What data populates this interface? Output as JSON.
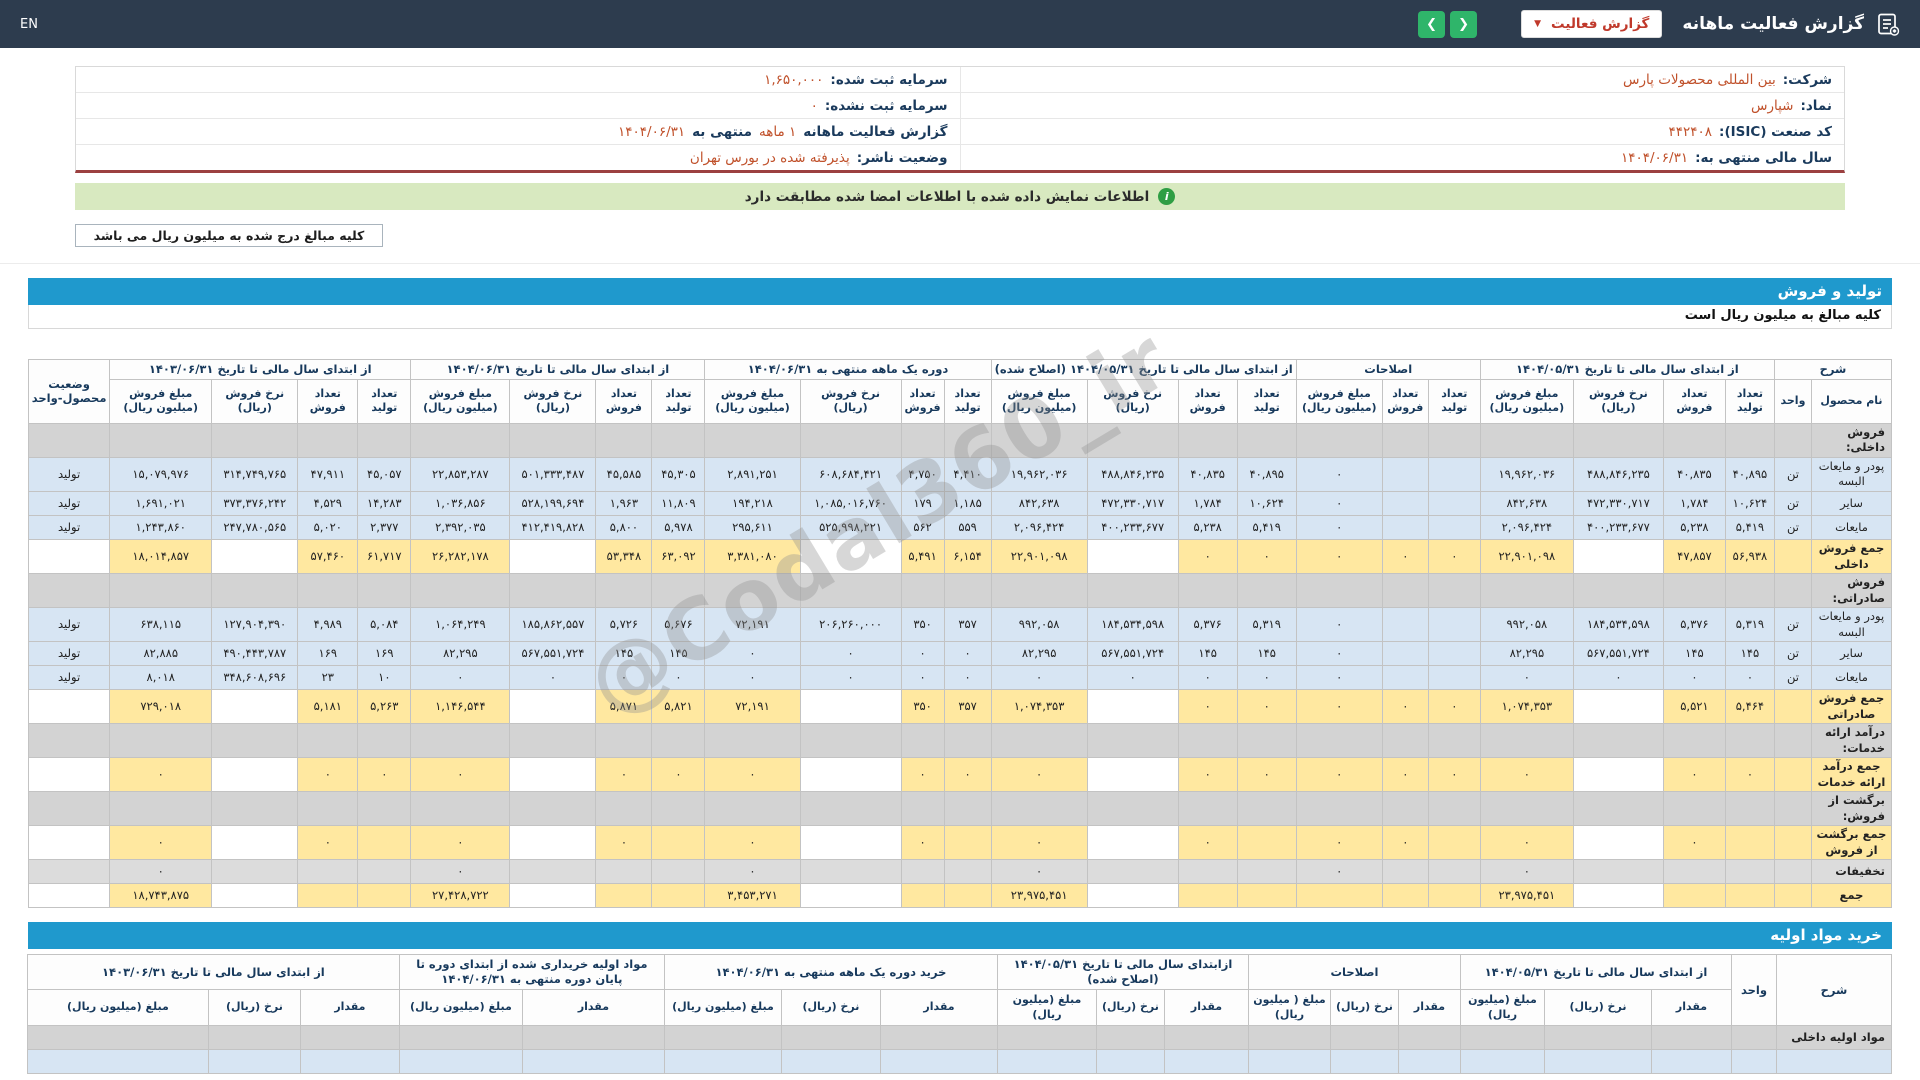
{
  "topbar": {
    "title": "گزارش فعالیت ماهانه",
    "dropdown_label": "گزارش فعالیت",
    "dropdown_caret": "▼",
    "prev_label": "❮",
    "next_label": "❯",
    "en_label": "EN"
  },
  "colors": {
    "topbar_bg": "#2d3c4e",
    "section_bar_bg": "#1f99cd",
    "nav_button_green": "#2fb56a",
    "dropdown_red": "#c0392b",
    "value_orange": "#c0512b",
    "banner_green_bg": "#d8e9c0",
    "banner_icon_green": "#2f9e44",
    "row_blue": "#d7e5f3",
    "row_yellow": "#ffe8a0",
    "row_gray": "#d3d3d3",
    "info_bottom_border_red": "#9c4040"
  },
  "company": {
    "rows": [
      {
        "right": [
          {
            "label": "شرکت:"
          },
          {
            "value": "بین المللی محصولات پارس"
          }
        ],
        "left": [
          {
            "label": "سرمایه ثبت شده:"
          },
          {
            "value": "۱,۶۵۰,۰۰۰"
          }
        ]
      },
      {
        "right": [
          {
            "label": "نماد:"
          },
          {
            "value": "شپارس"
          }
        ],
        "left": [
          {
            "label": "سرمایه ثبت نشده:"
          },
          {
            "value": "۰"
          }
        ]
      },
      {
        "right": [
          {
            "label": "کد صنعت (ISIC):"
          },
          {
            "value": "۴۴۲۴۰۸"
          }
        ],
        "left": [
          {
            "label": "گزارش فعالیت ماهانه"
          },
          {
            "value": "۱ ماهه"
          },
          {
            "label": "منتهی به"
          },
          {
            "value": "۱۴۰۴/۰۶/۳۱"
          }
        ]
      },
      {
        "right": [
          {
            "label": "سال مالی منتهی به:"
          },
          {
            "value": "۱۴۰۴/۰۶/۳۱"
          }
        ],
        "left": [
          {
            "label": "وضعیت ناشر:"
          },
          {
            "value": "پذیرفته شده در بورس تهران"
          }
        ]
      }
    ]
  },
  "banner": {
    "icon_glyph": "i",
    "text": "اطلاعات نمایش داده شده با اطلاعات امضا شده مطابقت دارد"
  },
  "amounts_note": "کلیه مبالغ درج شده به میلیون ریال می باشد",
  "watermark": "@Codal360_ir",
  "production_section": {
    "title": "تولید و فروش",
    "subtitle": "کلیه مبالغ به میلیون ریال است",
    "table": {
      "sharh_label": "شرح",
      "name_label": "نام محصول",
      "unit_label": "واحد",
      "status_label_line1": "وضعیت",
      "status_label_line2": "محصول-واحد",
      "groups": [
        {
          "label": "از ابتدای سال مالی تا تاریخ ۱۴۰۴/۰۵/۳۱",
          "cols": [
            "تعداد تولید",
            "تعداد فروش",
            "نرخ فروش (ریال)",
            "مبلغ فروش (میلیون ریال)"
          ]
        },
        {
          "label": "اصلاحات",
          "cols": [
            "تعداد تولید",
            "تعداد فروش",
            "مبلغ فروش (میلیون ریال)"
          ]
        },
        {
          "label": "از ابتدای سال مالی تا تاریخ ۱۴۰۴/۰۵/۳۱ (اصلاح شده)",
          "cols": [
            "تعداد تولید",
            "تعداد فروش",
            "نرخ فروش (ریال)",
            "مبلغ فروش (میلیون ریال)"
          ]
        },
        {
          "label": "دوره یک ماهه منتهی به ۱۴۰۴/۰۶/۳۱",
          "cols": [
            "تعداد تولید",
            "تعداد فروش",
            "نرخ فروش (ریال)",
            "مبلغ فروش (میلیون ریال)"
          ]
        },
        {
          "label": "از ابتدای سال مالی تا تاریخ ۱۴۰۴/۰۶/۳۱",
          "cols": [
            "تعداد تولید",
            "تعداد فروش",
            "نرخ فروش (ریال)",
            "مبلغ فروش (میلیون ریال)"
          ]
        },
        {
          "label": "از ابتدای سال مالی تا تاریخ ۱۴۰۳/۰۶/۳۱",
          "cols": [
            "تعداد تولید",
            "تعداد فروش",
            "نرخ فروش (ریال)",
            "مبلغ فروش (میلیون ریال)"
          ]
        }
      ],
      "rows": [
        {
          "type": "section",
          "name": "فروش داخلی:",
          "unit": "",
          "status": "",
          "cells": []
        },
        {
          "type": "product",
          "name": "پودر و مایعات البسه",
          "unit": "تن",
          "status": "تولید",
          "cells": [
            "۴۰,۸۹۵",
            "۴۰,۸۳۵",
            "۴۸۸,۸۴۶,۲۳۵",
            "۱۹,۹۶۲,۰۳۶",
            "",
            "",
            "۰",
            "۴۰,۸۹۵",
            "۴۰,۸۳۵",
            "۴۸۸,۸۴۶,۲۳۵",
            "۱۹,۹۶۲,۰۳۶",
            "۴,۴۱۰",
            "۴,۷۵۰",
            "۶۰۸,۶۸۴,۴۲۱",
            "۲,۸۹۱,۲۵۱",
            "۴۵,۳۰۵",
            "۴۵,۵۸۵",
            "۵۰۱,۳۳۳,۴۸۷",
            "۲۲,۸۵۳,۲۸۷",
            "۴۵,۰۵۷",
            "۴۷,۹۱۱",
            "۳۱۴,۷۴۹,۷۶۵",
            "۱۵,۰۷۹,۹۷۶"
          ]
        },
        {
          "type": "product",
          "name": "سایر",
          "unit": "تن",
          "status": "تولید",
          "cells": [
            "۱۰,۶۲۴",
            "۱,۷۸۴",
            "۴۷۲,۳۳۰,۷۱۷",
            "۸۴۲,۶۳۸",
            "",
            "",
            "۰",
            "۱۰,۶۲۴",
            "۱,۷۸۴",
            "۴۷۲,۳۳۰,۷۱۷",
            "۸۴۲,۶۳۸",
            "۱,۱۸۵",
            "۱۷۹",
            "۱,۰۸۵,۰۱۶,۷۶۰",
            "۱۹۴,۲۱۸",
            "۱۱,۸۰۹",
            "۱,۹۶۳",
            "۵۲۸,۱۹۹,۶۹۴",
            "۱,۰۳۶,۸۵۶",
            "۱۴,۲۸۳",
            "۴,۵۲۹",
            "۳۷۳,۳۷۶,۲۴۲",
            "۱,۶۹۱,۰۲۱"
          ]
        },
        {
          "type": "product",
          "name": "مایعات",
          "unit": "تن",
          "status": "تولید",
          "cells": [
            "۵,۴۱۹",
            "۵,۲۳۸",
            "۴۰۰,۲۳۳,۶۷۷",
            "۲,۰۹۶,۴۲۴",
            "",
            "",
            "۰",
            "۵,۴۱۹",
            "۵,۲۳۸",
            "۴۰۰,۲۳۳,۶۷۷",
            "۲,۰۹۶,۴۲۴",
            "۵۵۹",
            "۵۶۲",
            "۵۲۵,۹۹۸,۲۲۱",
            "۲۹۵,۶۱۱",
            "۵,۹۷۸",
            "۵,۸۰۰",
            "۴۱۲,۴۱۹,۸۲۸",
            "۲,۳۹۲,۰۳۵",
            "۲,۳۷۷",
            "۵,۰۲۰",
            "۲۴۷,۷۸۰,۵۶۵",
            "۱,۲۴۳,۸۶۰"
          ]
        },
        {
          "type": "total",
          "name": "جمع فروش داخلی",
          "unit": "",
          "status": "",
          "cells": [
            "۵۶,۹۳۸",
            "۴۷,۸۵۷",
            "",
            "۲۲,۹۰۱,۰۹۸",
            "۰",
            "۰",
            "۰",
            "۰",
            "۰",
            "",
            "۲۲,۹۰۱,۰۹۸",
            "۶,۱۵۴",
            "۵,۴۹۱",
            "",
            "۳,۳۸۱,۰۸۰",
            "۶۳,۰۹۲",
            "۵۳,۳۴۸",
            "",
            "۲۶,۲۸۲,۱۷۸",
            "۶۱,۷۱۷",
            "۵۷,۴۶۰",
            "",
            "۱۸,۰۱۴,۸۵۷"
          ]
        },
        {
          "type": "section",
          "name": "فروش صادراتی:",
          "unit": "",
          "status": "",
          "cells": []
        },
        {
          "type": "product",
          "name": "پودر و مایعات البسه",
          "unit": "تن",
          "status": "تولید",
          "cells": [
            "۵,۳۱۹",
            "۵,۳۷۶",
            "۱۸۴,۵۳۴,۵۹۸",
            "۹۹۲,۰۵۸",
            "",
            "",
            "۰",
            "۵,۳۱۹",
            "۵,۳۷۶",
            "۱۸۴,۵۳۴,۵۹۸",
            "۹۹۲,۰۵۸",
            "۳۵۷",
            "۳۵۰",
            "۲۰۶,۲۶۰,۰۰۰",
            "۷۲,۱۹۱",
            "۵,۶۷۶",
            "۵,۷۲۶",
            "۱۸۵,۸۶۲,۵۵۷",
            "۱,۰۶۴,۲۴۹",
            "۵,۰۸۴",
            "۴,۹۸۹",
            "۱۲۷,۹۰۴,۳۹۰",
            "۶۳۸,۱۱۵"
          ]
        },
        {
          "type": "product",
          "name": "سایر",
          "unit": "تن",
          "status": "تولید",
          "cells": [
            "۱۴۵",
            "۱۴۵",
            "۵۶۷,۵۵۱,۷۲۴",
            "۸۲,۲۹۵",
            "",
            "",
            "۰",
            "۱۴۵",
            "۱۴۵",
            "۵۶۷,۵۵۱,۷۲۴",
            "۸۲,۲۹۵",
            "۰",
            "۰",
            "۰",
            "۰",
            "۱۴۵",
            "۱۴۵",
            "۵۶۷,۵۵۱,۷۲۴",
            "۸۲,۲۹۵",
            "۱۶۹",
            "۱۶۹",
            "۴۹۰,۴۴۳,۷۸۷",
            "۸۲,۸۸۵"
          ]
        },
        {
          "type": "product",
          "name": "مایعات",
          "unit": "تن",
          "status": "تولید",
          "cells": [
            "۰",
            "۰",
            "۰",
            "۰",
            "",
            "",
            "۰",
            "۰",
            "۰",
            "۰",
            "۰",
            "۰",
            "۰",
            "۰",
            "۰",
            "۰",
            "۰",
            "۰",
            "۰",
            "۱۰",
            "۲۳",
            "۳۴۸,۶۰۸,۶۹۶",
            "۸,۰۱۸"
          ]
        },
        {
          "type": "total",
          "name": "جمع فروش صادراتی",
          "unit": "",
          "status": "",
          "cells": [
            "۵,۴۶۴",
            "۵,۵۲۱",
            "",
            "۱,۰۷۴,۳۵۳",
            "۰",
            "۰",
            "۰",
            "۰",
            "۰",
            "",
            "۱,۰۷۴,۳۵۳",
            "۳۵۷",
            "۳۵۰",
            "",
            "۷۲,۱۹۱",
            "۵,۸۲۱",
            "۵,۸۷۱",
            "",
            "۱,۱۴۶,۵۴۴",
            "۵,۲۶۳",
            "۵,۱۸۱",
            "",
            "۷۲۹,۰۱۸"
          ]
        },
        {
          "type": "section",
          "name": "درآمد ارائه خدمات:",
          "unit": "",
          "status": "",
          "cells": []
        },
        {
          "type": "total",
          "name": "جمع درآمد ارائه خدمات",
          "unit": "",
          "status": "",
          "cells": [
            "۰",
            "۰",
            "",
            "۰",
            "۰",
            "۰",
            "۰",
            "۰",
            "۰",
            "",
            "۰",
            "۰",
            "۰",
            "",
            "۰",
            "۰",
            "۰",
            "",
            "۰",
            "۰",
            "۰",
            "",
            "۰"
          ]
        },
        {
          "type": "section",
          "name": "برگشت از فروش:",
          "unit": "",
          "status": "",
          "cells": []
        },
        {
          "type": "total",
          "name": "جمع برگشت از فروش",
          "unit": "",
          "status": "",
          "cells": [
            "",
            "۰",
            "",
            "۰",
            "",
            "۰",
            "۰",
            "",
            "۰",
            "",
            "۰",
            "",
            "۰",
            "",
            "۰",
            "",
            "۰",
            "",
            "۰",
            "",
            "۰",
            "",
            "۰"
          ]
        },
        {
          "type": "discount",
          "name": "تخفیفات",
          "unit": "",
          "status": "",
          "cells": [
            "",
            "",
            "",
            "۰",
            "",
            "",
            "۰",
            "",
            "",
            "",
            "۰",
            "",
            "",
            "",
            "۰",
            "",
            "",
            "",
            "۰",
            "",
            "",
            "",
            "۰"
          ]
        },
        {
          "type": "grand",
          "name": "جمع",
          "unit": "",
          "status": "",
          "cells": [
            "",
            "",
            "",
            "۲۳,۹۷۵,۴۵۱",
            "",
            "",
            "",
            "",
            "",
            "",
            "۲۳,۹۷۵,۴۵۱",
            "",
            "",
            "",
            "۳,۴۵۳,۲۷۱",
            "",
            "",
            "",
            "۲۷,۴۲۸,۷۲۲",
            "",
            "",
            "",
            "۱۸,۷۴۳,۸۷۵"
          ]
        }
      ]
    }
  },
  "purchase_section": {
    "title": "خرید مواد اولیه",
    "table": {
      "sharh_label": "شرح",
      "unit_label": "واحد",
      "groups": [
        {
          "label": "از ابتدای سال مالی تا تاریخ ۱۴۰۴/۰۵/۳۱",
          "cols": [
            "مقدار",
            "نرخ (ریال)",
            "مبلغ (میلیون ریال)"
          ]
        },
        {
          "label": "اصلاحات",
          "cols": [
            "مقدار",
            "نرخ (ریال)",
            "مبلغ ( میلیون ریال)"
          ]
        },
        {
          "label": "ازابتدای سال مالی تا تاریخ ۱۴۰۴/۰۵/۳۱ (اصلاح شده)",
          "cols": [
            "مقدار",
            "نرخ (ریال)",
            "مبلغ (میلیون ریال)"
          ]
        },
        {
          "label": "خرید دوره یک ماهه منتهی به ۱۴۰۴/۰۶/۳۱",
          "cols": [
            "مقدار",
            "نرخ (ریال)",
            "مبلغ (میلیون ریال)"
          ]
        },
        {
          "label": "مواد اولیه خریداری شده از ابتدای دوره تا پایان دوره منتهی به ۱۴۰۴/۰۶/۳۱",
          "cols": [
            "مقدار",
            "مبلغ (میلیون ریال)"
          ]
        },
        {
          "label": "از ابتدای سال مالی تا تاریخ ۱۴۰۳/۰۶/۳۱",
          "cols": [
            "مقدار",
            "نرخ (ریال)",
            "مبلغ (میلیون ریال)"
          ]
        }
      ],
      "rows": [
        {
          "type": "section",
          "name": "مواد اولیه داخلی",
          "unit": "",
          "status": "",
          "cells": []
        },
        {
          "type": "product",
          "name": "",
          "unit": "",
          "status": "",
          "cells": []
        }
      ]
    }
  }
}
